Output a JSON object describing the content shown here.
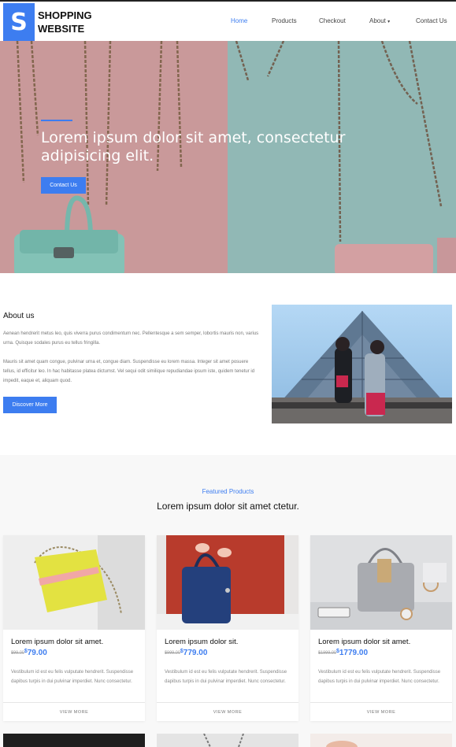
{
  "nav": {
    "logo_letter": "S",
    "logo_line1": "SHOPPING",
    "logo_line2": "WEBSITE",
    "items": [
      "Home",
      "Products",
      "Checkout",
      "About",
      "Contact Us"
    ],
    "about_caret": "▾"
  },
  "hero": {
    "title": "Lorem ipsum dolor sit amet, consectetur adipisicing elit.",
    "button": "Contact Us"
  },
  "about": {
    "title": "About us",
    "p1": "Aenean hendrerit metus leo, quis viverra purus condimentum nec. Pellentesque a sem semper, lobortis mauris non, varius urna. Quisque sodales purus eu tellus fringilla.",
    "p2": "Mauris sit amet quam congue, pulvinar urna et, congue diam. Suspendisse eu lorem massa. Integer sit amet posuere tellus, id efficitur leo. In hac habitasse platea dictumst. Vel sequi odit similique repudiandae ipsum iste, quidem tenetur id impedit, eaque et, aliquam quod.",
    "button": "Discover More"
  },
  "featured": {
    "label": "Featured Products",
    "title": "Lorem ipsum dolor sit amet ctetur.",
    "cards": [
      {
        "name": "Lorem ipsum dolor sit amet.",
        "old_price": "$99.00",
        "currency": "$",
        "price": "79.00",
        "desc": "Vestibulum id est eu felis vulputate hendrerit. Suspendisse dapibus turpis in dui pulvinar imperdiet. Nunc consectetur.",
        "footer": "VIEW MORE"
      },
      {
        "name": "Lorem ipsum dolor sit.",
        "old_price": "$999.00",
        "currency": "$",
        "price": "779.00",
        "desc": "Vestibulum id est eu felis vulputate hendrerit. Suspendisse dapibus turpis in dui pulvinar imperdiet. Nunc consectetur.",
        "footer": "VIEW MORE"
      },
      {
        "name": "Lorem ipsum dolor sit amet.",
        "old_price": "$1999.00",
        "currency": "$",
        "price": "1779.00",
        "desc": "Vestibulum id est eu felis vulputate hendrerit. Suspendisse dapibus turpis in dui pulvinar imperdiet. Nunc consectetur.",
        "footer": "VIEW MORE"
      }
    ]
  },
  "colors": {
    "accent": "#3d7df0"
  }
}
